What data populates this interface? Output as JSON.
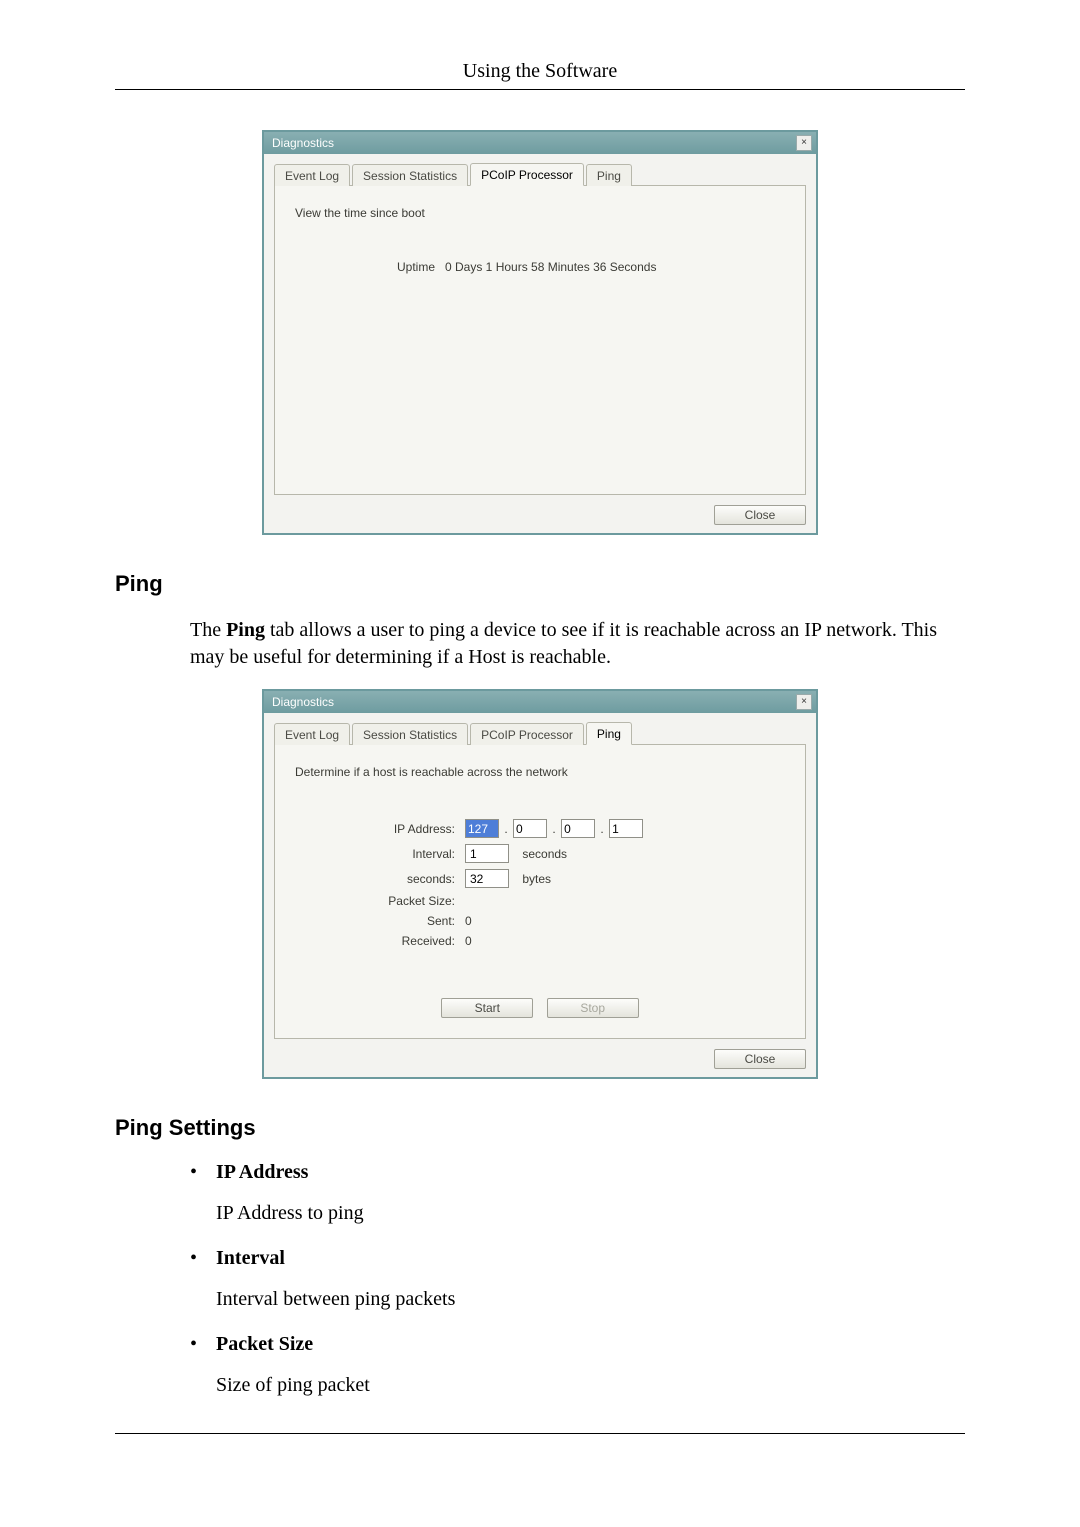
{
  "page_title": "Using the Software",
  "dialog1": {
    "title": "Diagnostics",
    "tabs": [
      "Event Log",
      "Session Statistics",
      "PCoIP Processor",
      "Ping"
    ],
    "active_tab_index": 2,
    "description": "View the time since boot",
    "uptime_label": "Uptime",
    "uptime_value": "0 Days 1 Hours 58 Minutes 36 Seconds",
    "close_label": "Close"
  },
  "section_ping_heading": "Ping",
  "section_ping_text_pre": "The ",
  "section_ping_text_bold": "Ping",
  "section_ping_text_post": " tab allows a user to ping a device to see if it is reachable across an IP network. This may be useful for determining if a Host is reachable.",
  "dialog2": {
    "title": "Diagnostics",
    "tabs": [
      "Event Log",
      "Session Statistics",
      "PCoIP Processor",
      "Ping"
    ],
    "active_tab_index": 3,
    "description": "Determine if a host is reachable across the network",
    "rows": {
      "ip_address_label": "IP Address:",
      "ip": [
        "127",
        "0",
        "0",
        "1"
      ],
      "interval_label": "Interval:",
      "interval_value": "1",
      "interval_unit": "seconds",
      "seconds_label": "seconds:",
      "seconds_value": "32",
      "seconds_unit": "bytes",
      "packet_size_label": "Packet Size:",
      "sent_label": "Sent:",
      "sent_value": "0",
      "received_label": "Received:",
      "received_value": "0"
    },
    "start_label": "Start",
    "stop_label": "Stop",
    "close_label": "Close"
  },
  "section_settings_heading": "Ping Settings",
  "settings_items": [
    {
      "head": "IP Address",
      "desc": "IP Address to ping"
    },
    {
      "head": "Interval",
      "desc": "Interval between ping packets"
    },
    {
      "head": "Packet Size",
      "desc": "Size of ping packet"
    }
  ]
}
